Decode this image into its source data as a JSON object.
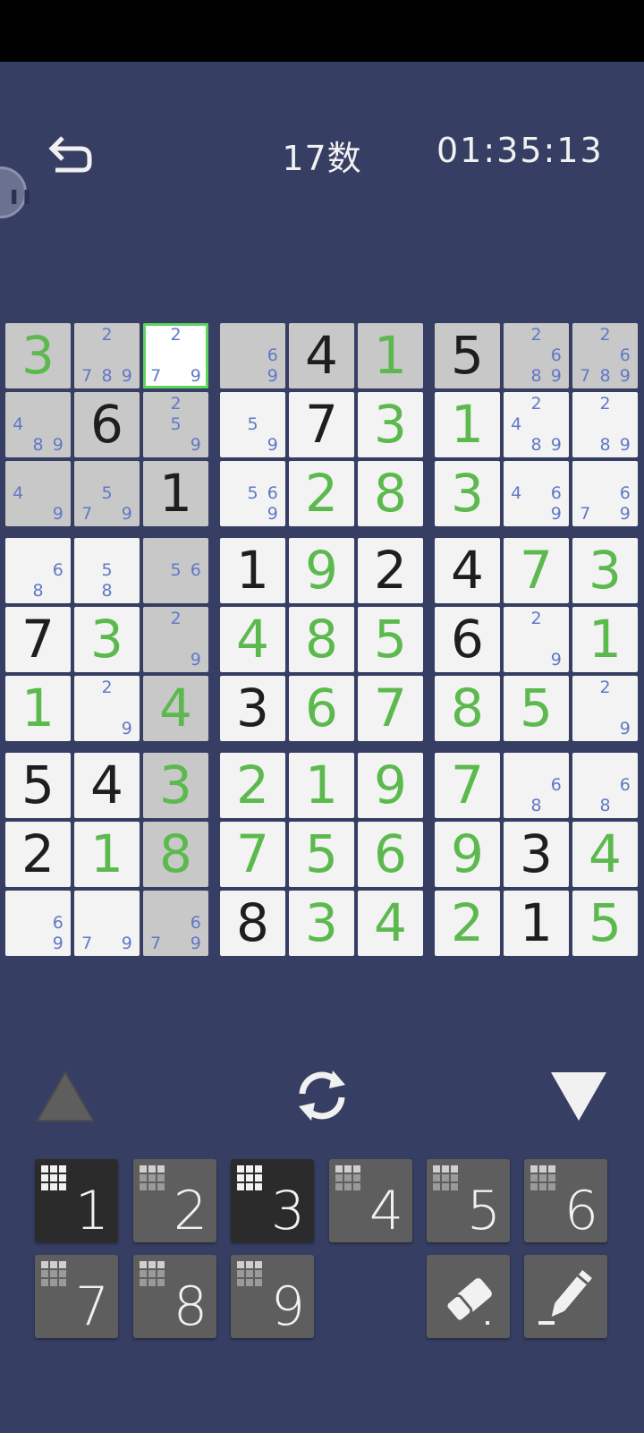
{
  "header": {
    "puzzle_title": "17数",
    "timer": "01:35:13"
  },
  "board": {
    "selected": [
      0,
      2
    ],
    "rows": [
      [
        {
          "v": "3",
          "t": "user",
          "bg": "g"
        },
        {
          "n": [
            "2",
            "7",
            "8",
            "9"
          ],
          "np": [
            2,
            7,
            8,
            9
          ],
          "bg": "g"
        },
        {
          "n": [
            "2",
            "7",
            "9"
          ],
          "np": [
            2,
            7,
            9
          ],
          "bg": "sel"
        },
        {
          "n": [
            "6",
            "9"
          ],
          "np": [
            6,
            9
          ],
          "bg": "g"
        },
        {
          "v": "4",
          "t": "given",
          "bg": "g"
        },
        {
          "v": "1",
          "t": "user",
          "bg": "g"
        },
        {
          "v": "5",
          "t": "given",
          "bg": "g"
        },
        {
          "n": [
            "2",
            "6",
            "8",
            "9"
          ],
          "np": [
            2,
            6,
            8,
            9
          ],
          "bg": "g"
        },
        {
          "n": [
            "2",
            "6",
            "7",
            "8",
            "9"
          ],
          "np": [
            2,
            6,
            7,
            8,
            9
          ],
          "bg": "g"
        }
      ],
      [
        {
          "n": [
            "4",
            "8",
            "9"
          ],
          "np": [
            4,
            8,
            9
          ],
          "bg": "g"
        },
        {
          "v": "6",
          "t": "given",
          "bg": "g"
        },
        {
          "n": [
            "2",
            "5",
            "9"
          ],
          "np": [
            2,
            5,
            9
          ],
          "bg": "g"
        },
        {
          "n": [
            "5",
            "9"
          ],
          "np": [
            5,
            9
          ],
          "bg": "w"
        },
        {
          "v": "7",
          "t": "given",
          "bg": "w"
        },
        {
          "v": "3",
          "t": "user",
          "bg": "w"
        },
        {
          "v": "1",
          "t": "user",
          "bg": "w"
        },
        {
          "n": [
            "2",
            "4",
            "8",
            "9"
          ],
          "np": [
            2,
            4,
            8,
            9
          ],
          "bg": "w"
        },
        {
          "n": [
            "2",
            "8",
            "9"
          ],
          "np": [
            2,
            8,
            9
          ],
          "bg": "w"
        }
      ],
      [
        {
          "n": [
            "4",
            "9"
          ],
          "np": [
            4,
            9
          ],
          "bg": "g"
        },
        {
          "n": [
            "5",
            "7",
            "9"
          ],
          "np": [
            5,
            7,
            9
          ],
          "bg": "g"
        },
        {
          "v": "1",
          "t": "given",
          "bg": "g"
        },
        {
          "n": [
            "5",
            "6",
            "9"
          ],
          "np": [
            5,
            6,
            9
          ],
          "bg": "w"
        },
        {
          "v": "2",
          "t": "user",
          "bg": "w"
        },
        {
          "v": "8",
          "t": "user",
          "bg": "w"
        },
        {
          "v": "3",
          "t": "user",
          "bg": "w"
        },
        {
          "n": [
            "4",
            "6",
            "9"
          ],
          "np": [
            4,
            6,
            9
          ],
          "bg": "w"
        },
        {
          "n": [
            "6",
            "7",
            "9"
          ],
          "np": [
            6,
            7,
            9
          ],
          "bg": "w"
        }
      ],
      [
        {
          "n": [
            "6",
            "8"
          ],
          "np": [
            6,
            8
          ],
          "bg": "w"
        },
        {
          "n": [
            "5",
            "8"
          ],
          "np": [
            5,
            8
          ],
          "bg": "w"
        },
        {
          "n": [
            "5",
            "6"
          ],
          "np": [
            5,
            6
          ],
          "bg": "g"
        },
        {
          "v": "1",
          "t": "given",
          "bg": "w"
        },
        {
          "v": "9",
          "t": "user",
          "bg": "w"
        },
        {
          "v": "2",
          "t": "given",
          "bg": "w"
        },
        {
          "v": "4",
          "t": "given",
          "bg": "w"
        },
        {
          "v": "7",
          "t": "user",
          "bg": "w"
        },
        {
          "v": "3",
          "t": "user",
          "bg": "w"
        }
      ],
      [
        {
          "v": "7",
          "t": "given",
          "bg": "w"
        },
        {
          "v": "3",
          "t": "user",
          "bg": "w"
        },
        {
          "n": [
            "2",
            "9"
          ],
          "np": [
            2,
            9
          ],
          "bg": "g"
        },
        {
          "v": "4",
          "t": "user",
          "bg": "w"
        },
        {
          "v": "8",
          "t": "user",
          "bg": "w"
        },
        {
          "v": "5",
          "t": "user",
          "bg": "w"
        },
        {
          "v": "6",
          "t": "given",
          "bg": "w"
        },
        {
          "n": [
            "2",
            "9"
          ],
          "np": [
            2,
            9
          ],
          "bg": "w"
        },
        {
          "v": "1",
          "t": "user",
          "bg": "w"
        }
      ],
      [
        {
          "v": "1",
          "t": "user",
          "bg": "w"
        },
        {
          "n": [
            "2",
            "9"
          ],
          "np": [
            2,
            9
          ],
          "bg": "w"
        },
        {
          "v": "4",
          "t": "user",
          "bg": "g"
        },
        {
          "v": "3",
          "t": "given",
          "bg": "w"
        },
        {
          "v": "6",
          "t": "user",
          "bg": "w"
        },
        {
          "v": "7",
          "t": "user",
          "bg": "w"
        },
        {
          "v": "8",
          "t": "user",
          "bg": "w"
        },
        {
          "v": "5",
          "t": "user",
          "bg": "w"
        },
        {
          "n": [
            "2",
            "9"
          ],
          "np": [
            2,
            9
          ],
          "bg": "w"
        }
      ],
      [
        {
          "v": "5",
          "t": "given",
          "bg": "w"
        },
        {
          "v": "4",
          "t": "given",
          "bg": "w"
        },
        {
          "v": "3",
          "t": "user",
          "bg": "g"
        },
        {
          "v": "2",
          "t": "user",
          "bg": "w"
        },
        {
          "v": "1",
          "t": "user",
          "bg": "w"
        },
        {
          "v": "9",
          "t": "user",
          "bg": "w"
        },
        {
          "v": "7",
          "t": "user",
          "bg": "w"
        },
        {
          "n": [
            "6",
            "8"
          ],
          "np": [
            6,
            8
          ],
          "bg": "w"
        },
        {
          "n": [
            "6",
            "8"
          ],
          "np": [
            6,
            8
          ],
          "bg": "w"
        }
      ],
      [
        {
          "v": "2",
          "t": "given",
          "bg": "w"
        },
        {
          "v": "1",
          "t": "user",
          "bg": "w"
        },
        {
          "v": "8",
          "t": "user",
          "bg": "g"
        },
        {
          "v": "7",
          "t": "user",
          "bg": "w"
        },
        {
          "v": "5",
          "t": "user",
          "bg": "w"
        },
        {
          "v": "6",
          "t": "user",
          "bg": "w"
        },
        {
          "v": "9",
          "t": "user",
          "bg": "w"
        },
        {
          "v": "3",
          "t": "given",
          "bg": "w"
        },
        {
          "v": "4",
          "t": "user",
          "bg": "w"
        }
      ],
      [
        {
          "n": [
            "6",
            "9"
          ],
          "np": [
            6,
            9
          ],
          "bg": "w"
        },
        {
          "n": [
            "7",
            "9"
          ],
          "np": [
            7,
            9
          ],
          "bg": "w"
        },
        {
          "n": [
            "6",
            "7",
            "9"
          ],
          "np": [
            6,
            7,
            9
          ],
          "bg": "g"
        },
        {
          "v": "8",
          "t": "given",
          "bg": "w"
        },
        {
          "v": "3",
          "t": "user",
          "bg": "w"
        },
        {
          "v": "4",
          "t": "user",
          "bg": "w"
        },
        {
          "v": "2",
          "t": "user",
          "bg": "w"
        },
        {
          "v": "1",
          "t": "given",
          "bg": "w"
        },
        {
          "v": "5",
          "t": "user",
          "bg": "w"
        }
      ]
    ]
  },
  "keypad": {
    "keys": [
      {
        "label": "1",
        "completed": true
      },
      {
        "label": "2",
        "completed": false
      },
      {
        "label": "3",
        "completed": true
      },
      {
        "label": "4",
        "completed": false
      },
      {
        "label": "5",
        "completed": false
      },
      {
        "label": "6",
        "completed": false
      },
      {
        "label": "7",
        "completed": false
      },
      {
        "label": "8",
        "completed": false
      },
      {
        "label": "9",
        "completed": false
      }
    ]
  },
  "colors": {
    "background": "#373e63",
    "given_digit": "#1e1e1e",
    "user_digit": "#5cb94e",
    "note_digit": "#6278c8",
    "selected_border": "#5fd35b",
    "cell_white": "#f2f3f2",
    "cell_highlight": "#c8c8c8"
  },
  "icons": {
    "undo": "undo-arrow-icon",
    "swap": "rotate-arrows-icon",
    "up": "triangle-up-icon",
    "down": "triangle-down-icon",
    "eraser": "eraser-icon",
    "pencil": "pencil-icon"
  }
}
